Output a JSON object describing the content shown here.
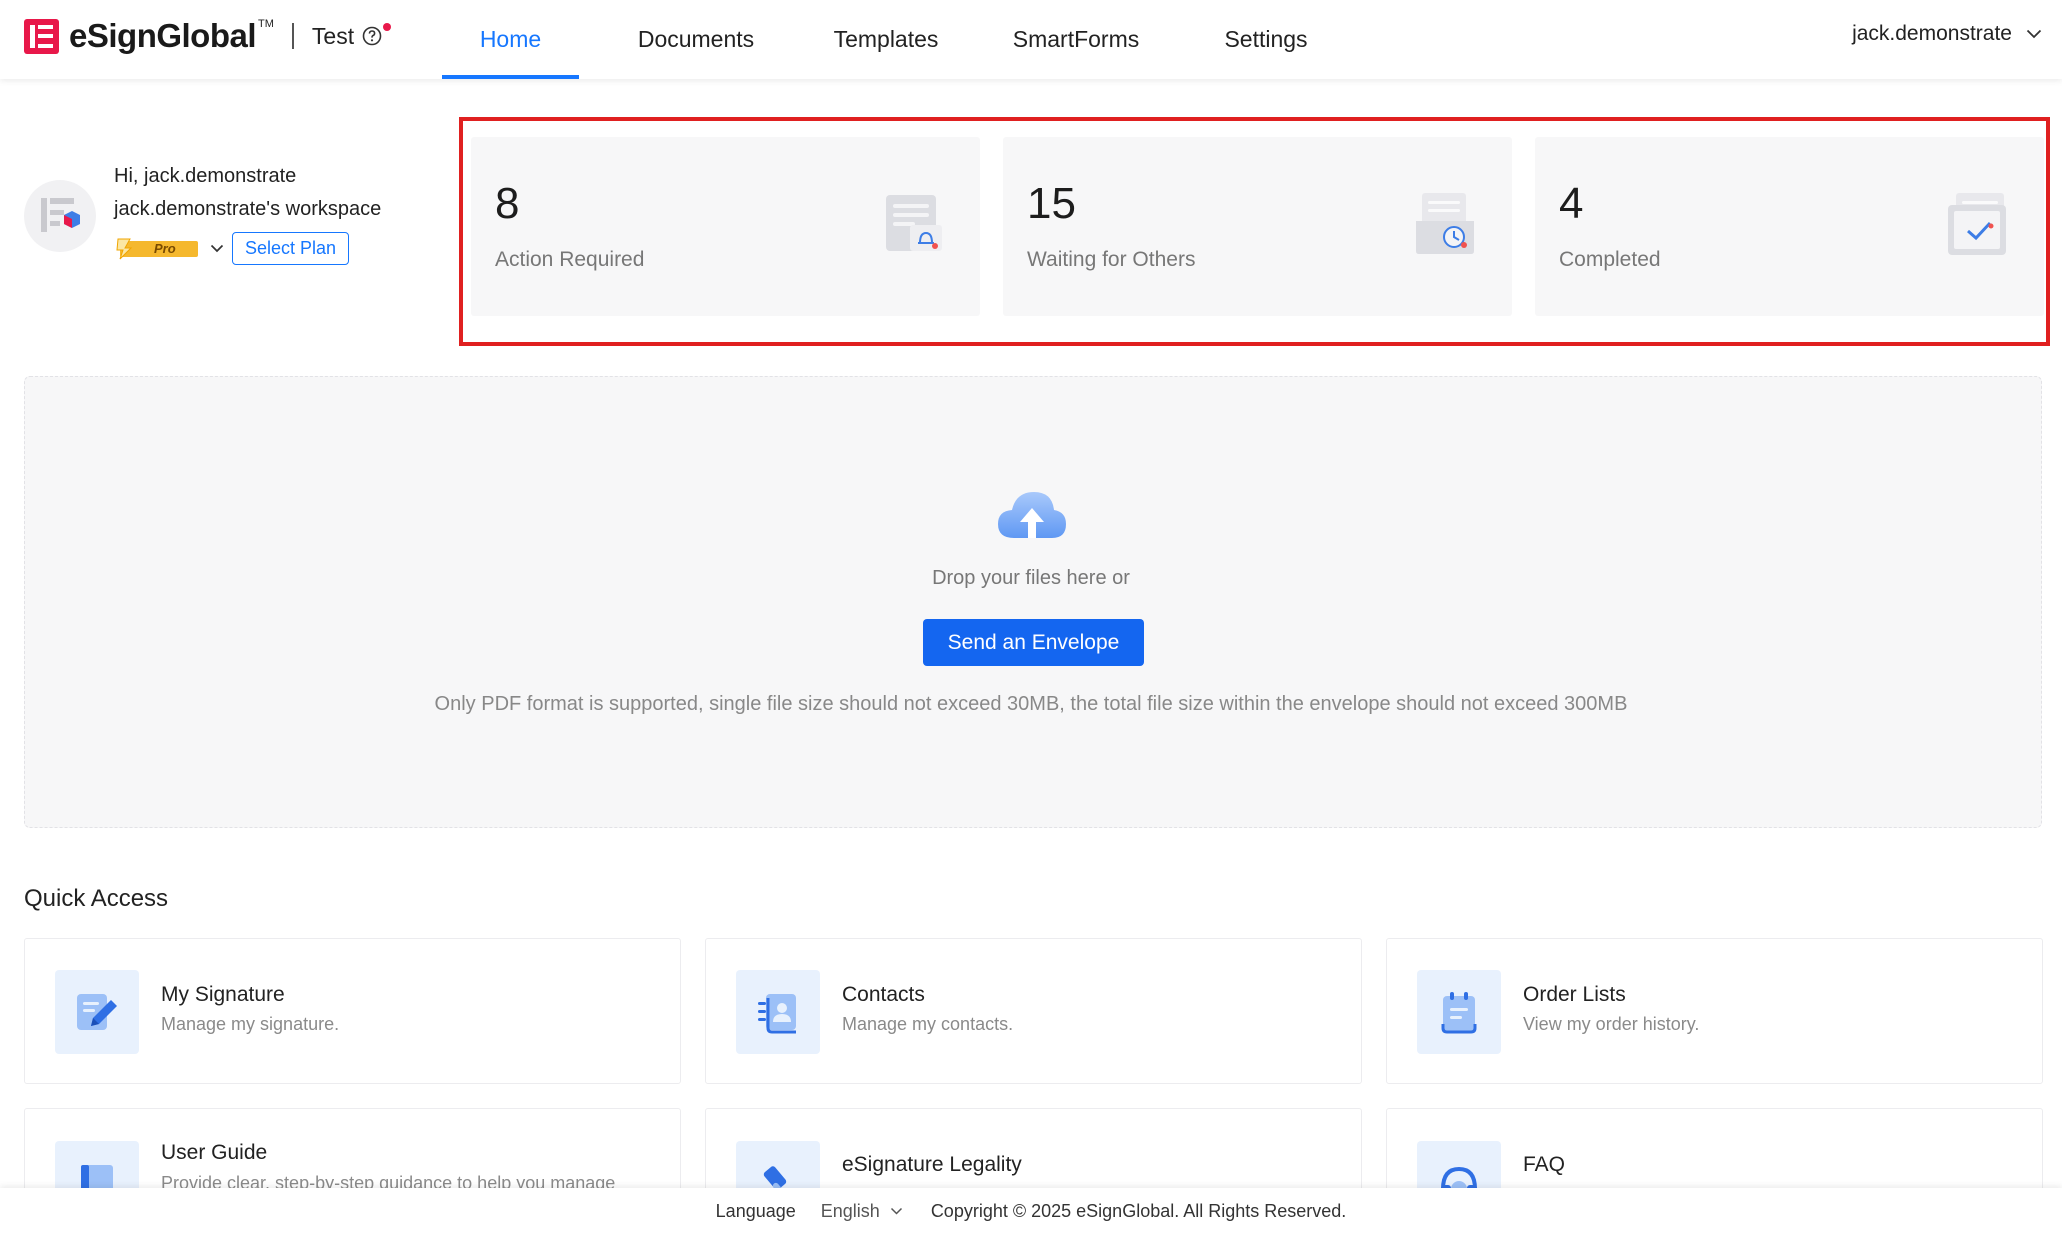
{
  "header": {
    "brand": "eSignGlobal",
    "trademark": "TM",
    "org_name": "Test",
    "nav": [
      {
        "label": "Home",
        "active": true
      },
      {
        "label": "Documents"
      },
      {
        "label": "Templates"
      },
      {
        "label": "SmartForms"
      },
      {
        "label": "Settings"
      }
    ],
    "user_name": "jack.demonstrate"
  },
  "profile": {
    "greeting": "Hi, jack.demonstrate",
    "workspace": "jack.demonstrate's workspace",
    "plan_badge": "Pro",
    "select_plan_label": "Select Plan"
  },
  "stats": [
    {
      "count": "8",
      "label": "Action Required",
      "icon": "bell-document-icon"
    },
    {
      "count": "15",
      "label": "Waiting for Others",
      "icon": "clock-document-icon"
    },
    {
      "count": "4",
      "label": "Completed",
      "icon": "check-document-icon"
    }
  ],
  "dropzone": {
    "prompt": "Drop your files here or",
    "button_label": "Send an Envelope",
    "hint": "Only PDF format is supported, single file size should not exceed 30MB, the total file size within the envelope should not exceed 300MB"
  },
  "quick_access": {
    "title": "Quick Access",
    "items": [
      {
        "name": "My Signature",
        "desc": "Manage my signature.",
        "icon": "signature-pen-icon"
      },
      {
        "name": "Contacts",
        "desc": "Manage my contacts.",
        "icon": "contacts-book-icon"
      },
      {
        "name": "Order Lists",
        "desc": "View my order history.",
        "icon": "order-list-icon"
      },
      {
        "name": "User Guide",
        "desc": "Provide clear, step-by-step guidance to help you manage",
        "icon": "book-icon"
      },
      {
        "name": "eSignature Legality",
        "desc": "",
        "icon": "gavel-icon"
      },
      {
        "name": "FAQ",
        "desc": "",
        "icon": "headset-icon"
      }
    ]
  },
  "footer": {
    "language_label": "Language",
    "language_value": "English",
    "copyright": "Copyright © 2025 eSignGlobal. All Rights Reserved."
  },
  "colors": {
    "accent": "#1677ff",
    "brand_red": "#e8184a",
    "highlight": "#e02020"
  }
}
